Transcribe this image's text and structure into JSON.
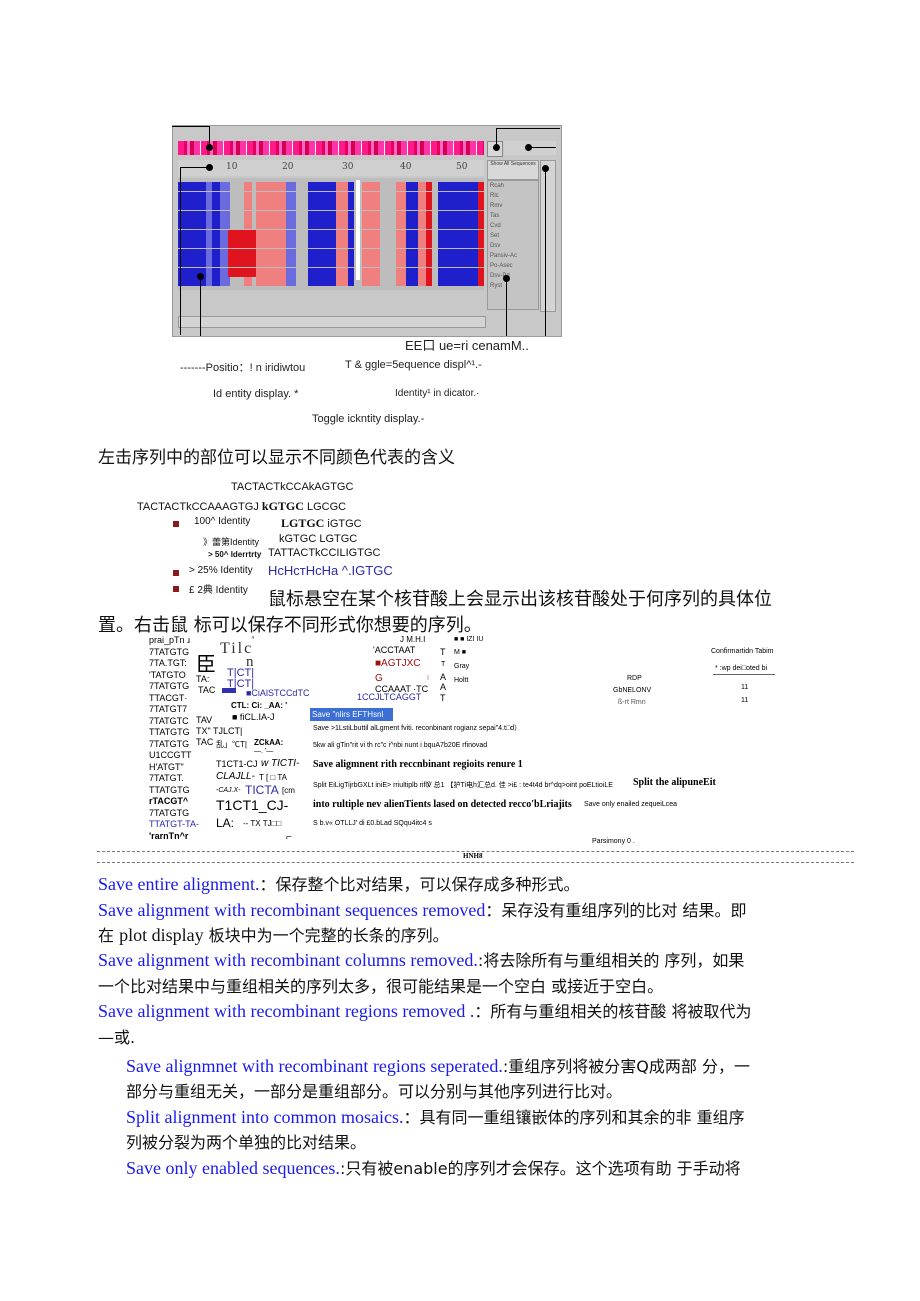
{
  "screenshot": {
    "ruler_ticks": [
      "10",
      "20",
      "30",
      "40",
      "50"
    ],
    "names_header": "Show All Sequences",
    "sequence_names": [
      "Rcah",
      "Rlc",
      "Rmv",
      "Tas",
      "Cvd",
      "Set",
      "Dsv",
      "Pansiv-Ac",
      "Po-Asec",
      "Dsv-Pd",
      "Ryst"
    ],
    "colors": {
      "identity_high": "#1f1fcc",
      "identity_mid": "#6b6be0",
      "recomb_red": "#e0141e",
      "recomb_pink": "#f08080",
      "overview_magenta": "#ff1a8c"
    }
  },
  "annotations": {
    "sequence_names": "EE口  ue=ri cenamM..",
    "position_indicator": "-------Positio：! n iridiwtou",
    "toggle_sequence": "T & ggle=5equence displ^¹.-",
    "identity_display": "Id entity display. *",
    "identity_indicator": "Identity¹ in dicator.·",
    "toggle_identity": "Toggle ickntity display.-"
  },
  "caption_left_click": "左击序列中的部位可以显示不同颜色代表的含义",
  "legend": {
    "seq_line1": "TACTACTkCCAkAGTGC",
    "seq_line2_a": "TACTACTkCCAAAGTGJ",
    "seq_line2_b": "kGTGC",
    "seq_line2_c": "LGCGC",
    "items": [
      {
        "label": "100^ Identity",
        "seq_bold": "LGTGC",
        "seq": "iGTGC"
      },
      {
        "label": "》蕾第Identity",
        "seq": "kGTGC LGTGC"
      },
      {
        "label": "> 50^ Iderrtrty",
        "seq": "TATTACTkCCILIGTGC"
      },
      {
        "label": "> 25% Identity",
        "seq": "HcHcтHcHa ^.IGTGC"
      },
      {
        "label": "£ 2典  Identity",
        "seq": ""
      }
    ],
    "bullet_color": "#8b1a1a"
  },
  "hover_text_line1": "鼠标悬空在某个核苷酸上会显示出该核苷酸处于何序列的具体位",
  "hover_text_line2": "置。右击鼠  标可以保存不同形式你想要的序列。",
  "context_menu_scan": {
    "left_seqs": [
      "prai_pTn ɹ",
      "7TATGTG",
      "7TA.TGT:",
      "'TATGTO",
      "7TATGTG",
      "TTACGT·",
      "7TATGT7",
      "7TATGTC",
      "TTATGTG",
      "7TATGTG",
      "U1CCGTT",
      "H'ATGT\"",
      "7TATGT.",
      "TTATGTG",
      "rTACGT^",
      "7TATGTG",
      "TTATGT-TA-",
      "'rarnTn^r"
    ],
    "mid_fragments": {
      "big_glyph": "臣",
      "tilc": "Tilc",
      "tilc_sup": "ᵘ",
      "n": "n",
      "ta1": "TA:",
      "tac1": "TAC",
      "tct1": "T|CT|",
      "tct2": "T|CT|",
      "ciaistcc": "■CiAlSTCCdTC",
      "ctl": "CTL:  Ci:  _AA:  '",
      "tav": "TAV",
      "ccl": "■ fiCL.IA-J",
      "tx": "TX\"  TJLCT|",
      "tac2": "TAC",
      "tac2b": "乱」℃T|",
      "zckaa": "ZCkAA:",
      "dash": "—. '—",
      "t1ct1": "T1CT1-CJ",
      "t1ct1_it": "w TICTI-",
      "clajll": "CLAJLL-",
      "clajll_b": "T [ □  TA",
      "cajx": "-CAJ.X-",
      "ticta": "TICTA",
      "ticta_b": "[cm",
      "t1ct1_big": "T1CT1_CJ-",
      "la": "LA:",
      "la_b": "-- TX TJ□□",
      "corner": "⌐"
    },
    "right_frags": {
      "j": "J  M.H.I",
      "acctaat": "'ACCTAAT",
      "agtjxc": "■AGTJXC",
      "g": "G",
      "bar": "I",
      "ccaaat": "CCAAAT  ·TC",
      "ccjlt": "1CCJLTCAGGT",
      "col_t1": "T",
      "col_t2": "T",
      "col_a1": "A",
      "col_a2": "A",
      "col_t3": "T",
      "leg1": "■ ■ IZI IU",
      "leg2": "M ■",
      "leg3": "Gray",
      "leg4": "Holtt"
    },
    "menu": {
      "highlighted": "Save \"nlirs EFTHsnl",
      "items": [
        "Save >1LstiLbuttil alLgment fviti. reconbinant rogianz sepai\"4.t□d）",
        "5kw ali gTin\"rit vi th rc\"c i^nbi nunt i bquA7b20E rfinovad",
        "Save aligmnent rith reccnbinant regioits renure 1",
        "Split EiLigTijrbGXLt iniE> rriultiplb rifl℣ 总1 【护Ti电h汇总d. 佳 >i£ : te4t4d br^dq>oint poELtioiLE",
        "Split the alipuneEit",
        "into rultiple nev alienTients lased on detected recco'bLriajits",
        "Save only enailed zequeiLcea",
        "S b.v« OTLLJ' di £0.bLad SQqu4itc4 s"
      ]
    },
    "confirmation": {
      "title": "Confirmartidn Tabim",
      "header": "* :wp dei□oted bi",
      "rows": [
        {
          "name": "RDP",
          "value": ""
        },
        {
          "name": "GbNELONV",
          "value": "11"
        },
        {
          "name": "ß-rt Rmn",
          "value": "11"
        }
      ]
    },
    "parsimony": "Parsimony 0 .",
    "footer_label": "HNH8"
  },
  "descriptions": [
    {
      "en": "Save entire alignment.",
      "zh": "：保存整个比对结果，可以保存成多种形式。"
    },
    {
      "en": "Save alignment with recombinant sequences removed",
      "zh": "：呆存没有重组序列的比对  结果。即"
    },
    {
      "cont_zh1": "在  ",
      "cont_en": "plot display",
      "cont_zh2": " 板块中为一个完整的长条的序列。"
    },
    {
      "en": "Save alignment with recombinant columns removed.",
      "zh": ":将去除所有与重组相关的  序列，如果"
    },
    {
      "cont_zh": "一个比对结果中与重组相关的序列太多，很可能结果是一个空白  或接近于空白。"
    },
    {
      "en": "Save alignment with recombinant regions removed .",
      "zh": "：所有与重组相关的核苷酸  将被取代为"
    },
    {
      "cont_zh": "—或."
    },
    {
      "en": "Save alignmnet with recombinant regions seperated.",
      "zh": ":重组序列将被分害Q成两部  分，一"
    },
    {
      "cont_zh": "部分与重组无关，一部分是重组部分。可以分别与其他序列进行比对。"
    },
    {
      "en": "Split alignment into common mosaics.",
      "zh": "：具有同一重组镶嵌体的序列和其余的非  重组序"
    },
    {
      "cont_zh": "列被分裂为两个单独的比对结果。"
    },
    {
      "en": "Save only enabled sequences.",
      "zh": ":只有被enable的序列才会保存。这个选项有助  于手动将"
    }
  ]
}
